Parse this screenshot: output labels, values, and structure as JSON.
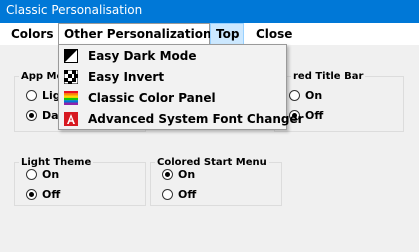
{
  "window": {
    "title": "Classic Personalisation"
  },
  "menubar": {
    "items": [
      {
        "label": "Colors"
      },
      {
        "label": "Other Personalization"
      },
      {
        "label": "Top"
      },
      {
        "label": "Close"
      }
    ]
  },
  "dropdown": {
    "items": [
      {
        "label": "Easy Dark Mode",
        "icon": "easy-dark-mode-icon"
      },
      {
        "label": "Easy Invert",
        "icon": "easy-invert-icon"
      },
      {
        "label": "Classic Color Panel",
        "icon": "classic-color-panel-icon"
      },
      {
        "label": "Advanced System Font Changer",
        "icon": "font-changer-icon"
      }
    ]
  },
  "groups": {
    "app_mode": {
      "caption": "App Mo",
      "options": [
        {
          "label": "Lig",
          "selected": false
        },
        {
          "label": "Dar",
          "selected": true
        }
      ]
    },
    "colored_title_bar": {
      "caption": "red Title Bar",
      "options": [
        {
          "label": "On",
          "selected": false
        },
        {
          "label": "Off",
          "selected": true
        }
      ]
    },
    "light_theme": {
      "caption": "Light Theme",
      "options": [
        {
          "label": "On",
          "selected": false
        },
        {
          "label": "Off",
          "selected": true
        }
      ]
    },
    "colored_start_menu": {
      "caption": "Colored Start Menu",
      "options": [
        {
          "label": "On",
          "selected": true
        },
        {
          "label": "Off",
          "selected": false
        }
      ]
    }
  },
  "colors": {
    "titlebar": "#0078d7",
    "menu_hover": "#cce8ff",
    "background": "#f0f0f0"
  }
}
